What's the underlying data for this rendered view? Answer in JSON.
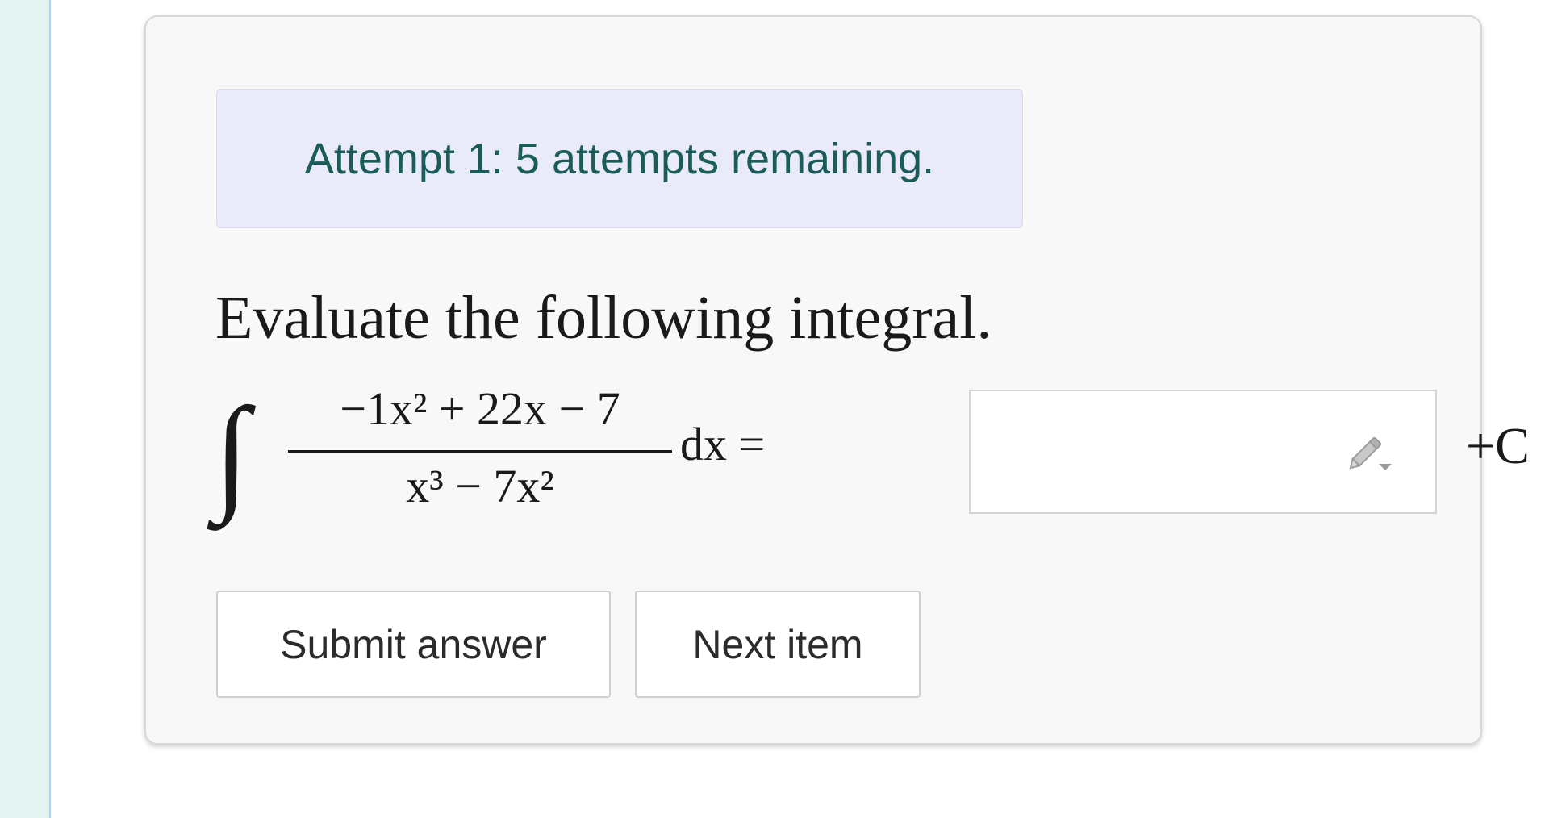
{
  "status": {
    "attempt_text": "Attempt 1: 5 attempts remaining."
  },
  "question": {
    "prompt": "Evaluate the following integral.",
    "integral_sign": "∫",
    "numerator": "−1x² + 22x − 7",
    "denominator": "x³ − 7x²",
    "dx_equals": "dx =",
    "constant": "+C"
  },
  "answer": {
    "value": "",
    "icon": "pencil-icon"
  },
  "buttons": {
    "submit": "Submit answer",
    "next": "Next item"
  },
  "colors": {
    "banner_bg": "#e9ebfa",
    "banner_text": "#1b5b5a",
    "left_strip": "#e4f4f0"
  }
}
